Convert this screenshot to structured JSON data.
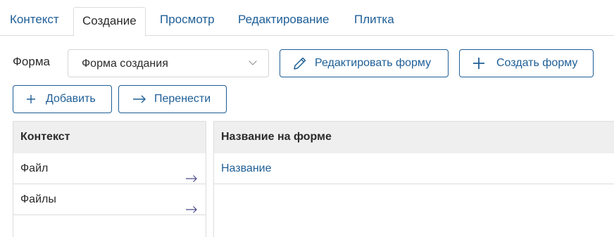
{
  "tabs": [
    {
      "label": "Контекст",
      "active": false
    },
    {
      "label": "Создание",
      "active": true
    },
    {
      "label": "Просмотр",
      "active": false
    },
    {
      "label": "Редактирование",
      "active": false
    },
    {
      "label": "Плитка",
      "active": false
    }
  ],
  "form": {
    "label": "Форма",
    "selected": "Форма создания"
  },
  "buttons": {
    "edit_form": "Редактировать форму",
    "create_form": "Создать форму",
    "add": "Добавить",
    "move": "Перенести"
  },
  "context_panel": {
    "header": "Контекст",
    "items": [
      {
        "label": "Файл"
      },
      {
        "label": "Файлы"
      }
    ]
  },
  "form_panel": {
    "header": "Название на форме",
    "items": [
      {
        "label": "Название"
      }
    ]
  },
  "colors": {
    "accent": "#1e5e96",
    "border": "#dcdcdc",
    "header_bg": "#efefef",
    "arrow": "#4a4a8a"
  }
}
